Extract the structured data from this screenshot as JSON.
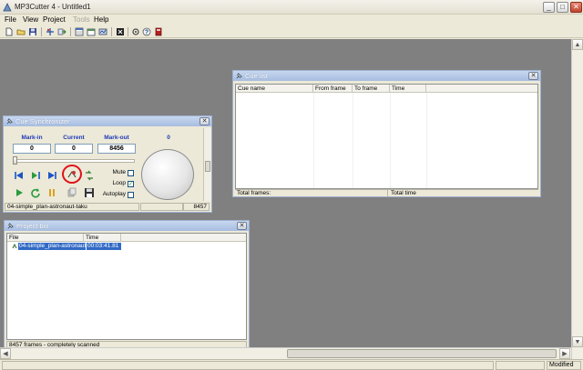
{
  "app": {
    "title": "MP3Cutter 4 - Untitled1"
  },
  "window_buttons": {
    "minimize": "_",
    "maximize": "□",
    "close": "✕"
  },
  "menu": [
    {
      "label": "File",
      "enabled": true
    },
    {
      "label": "View",
      "enabled": true
    },
    {
      "label": "Project",
      "enabled": true
    },
    {
      "label": "Tools",
      "enabled": false
    },
    {
      "label": "Help",
      "enabled": true
    }
  ],
  "toolbar_icons": [
    "new-file-icon",
    "open-folder-icon",
    "save-icon",
    "split-icon",
    "export-icon",
    "cue-list-icon",
    "project-bin-icon",
    "synchronizer-icon",
    "cut-icon",
    "settings-icon",
    "help-icon",
    "exit-icon"
  ],
  "cue_list": {
    "title": "Cue list",
    "columns": [
      "Cue name",
      "From frame",
      "To frame",
      "Time"
    ],
    "footer_left": "Total frames:",
    "footer_right": "Total time"
  },
  "synchronizer": {
    "title": "Cue Synchronizer",
    "labels": {
      "mark_in": "Mark-in",
      "current": "Current",
      "mark_out": "Mark-out",
      "volume": "0"
    },
    "values": {
      "mark_in": "0",
      "current": "0",
      "mark_out": "8456"
    },
    "options": [
      {
        "label": "Mute",
        "checked": false
      },
      {
        "label": "Loop",
        "checked": true
      },
      {
        "label": "Autoplay",
        "checked": false
      }
    ],
    "path": "04-simple_plan-astronaut-taku",
    "frame_total": "8457",
    "position_fraction": 0.0
  },
  "project_bin": {
    "title": "Project bin",
    "columns": [
      "File",
      "Time"
    ],
    "rows": [
      {
        "file": "04-simple_plan-astronaut",
        "time": "00:03:41.81",
        "selected": true
      }
    ],
    "status": "8457 frames - completely scanned"
  },
  "statusbar": {
    "state": "Modified"
  },
  "colors": {
    "workspace": "#808080",
    "accent_title": "#3f6fd1",
    "selection": "#316ac5",
    "annotation": "#e0101a"
  }
}
